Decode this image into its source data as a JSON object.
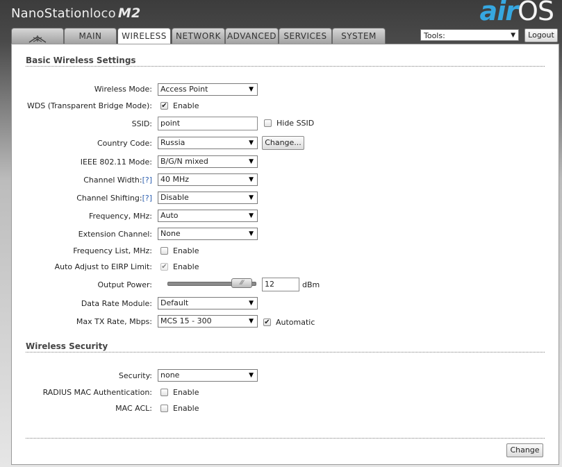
{
  "header": {
    "brand_name": "NanoStation",
    "brand_sub": "loco",
    "brand_model": "M2",
    "logo_air": "air",
    "logo_os": "OS"
  },
  "tabs": [
    {
      "label": "",
      "icon": "ubiquiti-logo-icon"
    },
    {
      "label": "MAIN"
    },
    {
      "label": "WIRELESS",
      "active": true
    },
    {
      "label": "NETWORK"
    },
    {
      "label": "ADVANCED"
    },
    {
      "label": "SERVICES"
    },
    {
      "label": "SYSTEM"
    }
  ],
  "toolbar": {
    "tools_value": "Tools:",
    "logout_label": "Logout"
  },
  "basic": {
    "title": "Basic Wireless Settings",
    "wireless_mode": {
      "label": "Wireless Mode:",
      "value": "Access Point"
    },
    "wds": {
      "label": "WDS (Transparent Bridge Mode):",
      "option": "Enable",
      "checked": true
    },
    "ssid": {
      "label": "SSID:",
      "value": "point",
      "hide_label": "Hide SSID",
      "hide_checked": false
    },
    "country": {
      "label": "Country Code:",
      "value": "Russia",
      "change_label": "Change..."
    },
    "ieee_mode": {
      "label": "IEEE 802.11 Mode:",
      "value": "B/G/N mixed"
    },
    "channel_width": {
      "label": "Channel Width:",
      "help": "[?]",
      "value": "40 MHz"
    },
    "channel_shifting": {
      "label": "Channel Shifting:",
      "help": "[?]",
      "value": "Disable"
    },
    "frequency": {
      "label": "Frequency, MHz:",
      "value": "Auto"
    },
    "extension_channel": {
      "label": "Extension Channel:",
      "value": "None"
    },
    "frequency_list": {
      "label": "Frequency List, MHz:",
      "option": "Enable",
      "checked": false
    },
    "auto_adjust": {
      "label": "Auto Adjust to EIRP Limit:",
      "option": "Enable",
      "checked": true,
      "disabled": true
    },
    "output_power": {
      "label": "Output Power:",
      "value": "12",
      "unit": "dBm",
      "level": 0.85
    },
    "data_rate": {
      "label": "Data Rate Module:",
      "value": "Default"
    },
    "max_tx": {
      "label": "Max TX Rate, Mbps:",
      "value": "MCS 15 - 300",
      "auto_label": "Automatic",
      "auto_checked": true
    }
  },
  "security": {
    "title": "Wireless Security",
    "security": {
      "label": "Security:",
      "value": "none"
    },
    "radius_mac": {
      "label": "RADIUS MAC Authentication:",
      "option": "Enable",
      "checked": false
    },
    "mac_acl": {
      "label": "MAC ACL:",
      "option": "Enable",
      "checked": false
    }
  },
  "footer": {
    "change_label": "Change"
  }
}
